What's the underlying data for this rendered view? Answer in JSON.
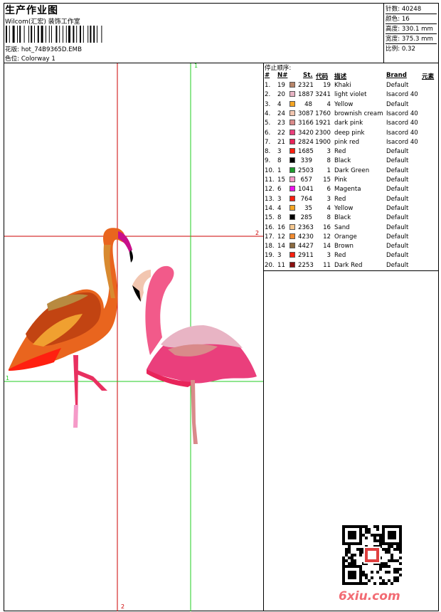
{
  "header": {
    "title": "生产作业图",
    "subtitle": "Wilcom(汇宏) 装饰工作室",
    "design_label": "花版:",
    "design_file": "hot_74B9365D.EMB",
    "colorway_label": "色位:",
    "colorway": "Colorway 1"
  },
  "stats": [
    {
      "label": "针数:",
      "value": "40248"
    },
    {
      "label": "颜色:",
      "value": "16"
    },
    {
      "label": "高度:",
      "value": "330.1 mm"
    },
    {
      "label": "宽度:",
      "value": "375.3 mm"
    },
    {
      "label": "比例:",
      "value": "0.32"
    }
  ],
  "stop_sequence": {
    "title": "停止顺序:",
    "headers": {
      "num": "#",
      "n": "N#",
      "st": "St.",
      "code": "代码",
      "desc": "描述",
      "brand": "Brand",
      "element": "元素"
    },
    "rows": [
      {
        "num": "1.",
        "n": "19",
        "color": "#b8866a",
        "st": "2321",
        "code": "19",
        "desc": "Khaki",
        "brand": "Default"
      },
      {
        "num": "2.",
        "n": "20",
        "color": "#e8b4c4",
        "st": "1887",
        "code": "3241",
        "desc": "light violet",
        "brand": "Isacord 40"
      },
      {
        "num": "3.",
        "n": "4",
        "color": "#f5a623",
        "st": "48",
        "code": "4",
        "desc": "Yellow",
        "brand": "Default"
      },
      {
        "num": "4.",
        "n": "24",
        "color": "#f2c6b0",
        "st": "3087",
        "code": "1760",
        "desc": "brownish cream",
        "brand": "Isacord 40"
      },
      {
        "num": "5.",
        "n": "23",
        "color": "#d98a8a",
        "st": "3166",
        "code": "1921",
        "desc": "dark pink",
        "brand": "Isacord 40"
      },
      {
        "num": "6.",
        "n": "22",
        "color": "#ea3f7c",
        "st": "3420",
        "code": "2300",
        "desc": "deep pink",
        "brand": "Isacord 40"
      },
      {
        "num": "7.",
        "n": "21",
        "color": "#e8245a",
        "st": "2824",
        "code": "1900",
        "desc": "pink red",
        "brand": "Isacord 40"
      },
      {
        "num": "8.",
        "n": "3",
        "color": "#ff2010",
        "st": "1685",
        "code": "3",
        "desc": "Red",
        "brand": "Default"
      },
      {
        "num": "9.",
        "n": "8",
        "color": "#000000",
        "st": "339",
        "code": "8",
        "desc": "Black",
        "brand": "Default"
      },
      {
        "num": "10.",
        "n": "1",
        "color": "#1e9a2e",
        "st": "2503",
        "code": "1",
        "desc": "Dark Green",
        "brand": "Default"
      },
      {
        "num": "11.",
        "n": "15",
        "color": "#f59ac8",
        "st": "657",
        "code": "15",
        "desc": "Pink",
        "brand": "Default"
      },
      {
        "num": "12.",
        "n": "6",
        "color": "#ee10ee",
        "st": "1041",
        "code": "6",
        "desc": "Magenta",
        "brand": "Default"
      },
      {
        "num": "13.",
        "n": "3",
        "color": "#ff2010",
        "st": "764",
        "code": "3",
        "desc": "Red",
        "brand": "Default"
      },
      {
        "num": "14.",
        "n": "4",
        "color": "#f5a623",
        "st": "35",
        "code": "4",
        "desc": "Yellow",
        "brand": "Default"
      },
      {
        "num": "15.",
        "n": "8",
        "color": "#000000",
        "st": "285",
        "code": "8",
        "desc": "Black",
        "brand": "Default"
      },
      {
        "num": "16.",
        "n": "16",
        "color": "#f5c890",
        "st": "2363",
        "code": "16",
        "desc": "Sand",
        "brand": "Default"
      },
      {
        "num": "17.",
        "n": "12",
        "color": "#f08a30",
        "st": "4230",
        "code": "12",
        "desc": "Orange",
        "brand": "Default"
      },
      {
        "num": "18.",
        "n": "14",
        "color": "#8a6a40",
        "st": "4427",
        "code": "14",
        "desc": "Brown",
        "brand": "Default"
      },
      {
        "num": "19.",
        "n": "3",
        "color": "#ff2010",
        "st": "2911",
        "code": "3",
        "desc": "Red",
        "brand": "Default"
      },
      {
        "num": "20.",
        "n": "11",
        "color": "#8a1010",
        "st": "2253",
        "code": "11",
        "desc": "Dark Red",
        "brand": "Default"
      }
    ]
  },
  "guides": {
    "red_v_label": "2",
    "red_h_label": "2",
    "green_v_label": "1",
    "green_h_label": "1"
  },
  "watermark": "6xiu.com",
  "colors": {
    "red_guide": "#cc0000",
    "green_guide": "#22cc22",
    "watermark": "#f26b73"
  }
}
